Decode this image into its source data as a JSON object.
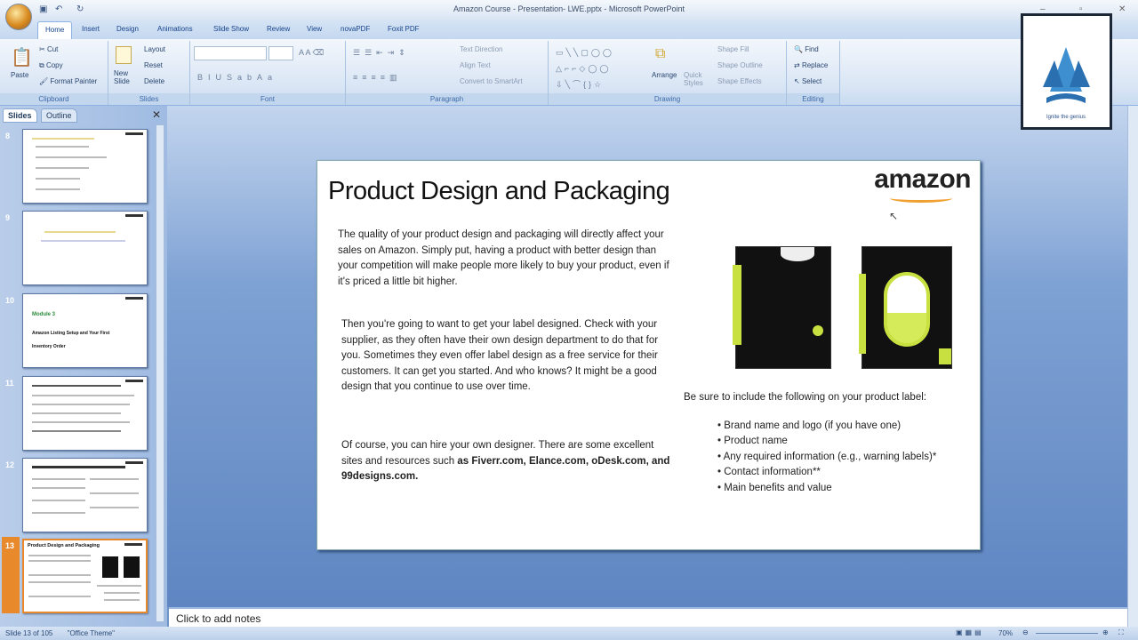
{
  "window": {
    "title": "Amazon Course - Presentation- LWE.pptx - Microsoft PowerPoint",
    "controls": [
      "–",
      "▫",
      "✕"
    ]
  },
  "tabs": [
    "Home",
    "Insert",
    "Design",
    "Animations",
    "Slide Show",
    "Review",
    "View",
    "novaPDF",
    "Foxit PDF"
  ],
  "ribbon": {
    "clipboard": {
      "label": "Clipboard",
      "paste": "Paste",
      "cut": "Cut",
      "copy": "Copy",
      "format_painter": "Format Painter"
    },
    "slides": {
      "label": "Slides",
      "new_slide": "New Slide",
      "layout": "Layout",
      "reset": "Reset",
      "delete": "Delete"
    },
    "font": {
      "label": "Font"
    },
    "paragraph": {
      "label": "Paragraph",
      "text_direction": "Text Direction",
      "align_text": "Align Text",
      "smartart": "Convert to SmartArt"
    },
    "drawing": {
      "label": "Drawing",
      "arrange": "Arrange",
      "quick_styles": "Quick Styles",
      "shape_fill": "Shape Fill",
      "shape_outline": "Shape Outline",
      "shape_effects": "Shape Effects"
    },
    "editing": {
      "label": "Editing",
      "find": "Find",
      "replace": "Replace",
      "select": "Select"
    }
  },
  "panel": {
    "tabs": [
      "Slides",
      "Outline"
    ],
    "close": "✕",
    "thumbs": [
      {
        "num": "8"
      },
      {
        "num": "9"
      },
      {
        "num": "10",
        "title": "Module 3",
        "line1": "Amazon Listing Setup and Your First",
        "line2": "Inventory Order"
      },
      {
        "num": "11"
      },
      {
        "num": "12"
      },
      {
        "num": "13",
        "title": "Product Design and Packaging"
      }
    ]
  },
  "slide": {
    "title": "Product Design and Packaging",
    "logo": "amazon",
    "p1": "The quality of your product design and packaging will directly affect your sales on Amazon. Simply put, having a product with better design than your competition will make people more likely to buy your product, even if it's priced a little bit higher.",
    "p2": "Then you're going to want to get your label designed. Check with your supplier, as they often  have their own design department to do that for you. Sometimes they even offer label design as a free service for their customers. It can get you started. And who knows? It might be a good design that you continue to use over time.",
    "p3a": "Of course, you can hire your own designer. There are some excellent sites and resources such ",
    "p3b": "as Fiverr.com, Elance.com, oDesk.com, and 99designs.com.",
    "label_intro": "Be sure to include the following on your product label:",
    "bullets": [
      "Brand name and logo (if you have one)",
      "Product name",
      "Any required information (e.g., warning labels)*",
      "Contact information**",
      "Main benefits and value"
    ]
  },
  "notes": "Click to add notes",
  "status": {
    "slide": "Slide 13 of 105",
    "theme": "\"Office Theme\"",
    "zoom": "70%"
  },
  "watermark": "Ignite the genius"
}
